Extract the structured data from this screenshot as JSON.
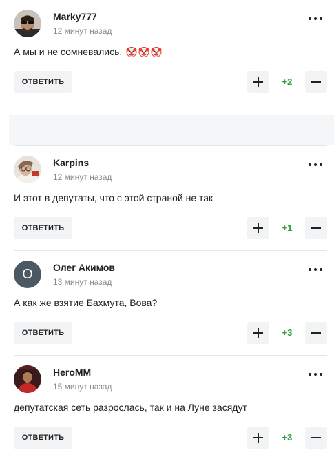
{
  "reply_label": "ОТВЕТИТЬ",
  "colors": {
    "accent_positive": "#2ea043",
    "button_bg": "#f2f3f4",
    "muted_text": "#8a8a8a"
  },
  "comments": [
    {
      "author": "Marky777",
      "time": "12 минут назад",
      "text": "А мы и не сомневались.",
      "emojis": [
        "clown-face",
        "clown-face",
        "clown-face"
      ],
      "score": "+2",
      "avatar": "photo-man-sunglasses"
    },
    {
      "author": "Karpins",
      "time": "12 минут назад",
      "text": "И этот в депутаты, что с этой страной не так",
      "score": "+1",
      "avatar": "photo-person-glasses"
    },
    {
      "author": "Олег Акимов",
      "time": "13 минут назад",
      "text": "А как же взятие Бахмута, Вова?",
      "score": "+3",
      "avatar_letter": "О"
    },
    {
      "author": "HeroMM",
      "time": "15 минут назад",
      "text": "депутатская сеть разрослась, так и на Луне засядут",
      "score": "+3",
      "avatar": "photo-red-player"
    }
  ]
}
